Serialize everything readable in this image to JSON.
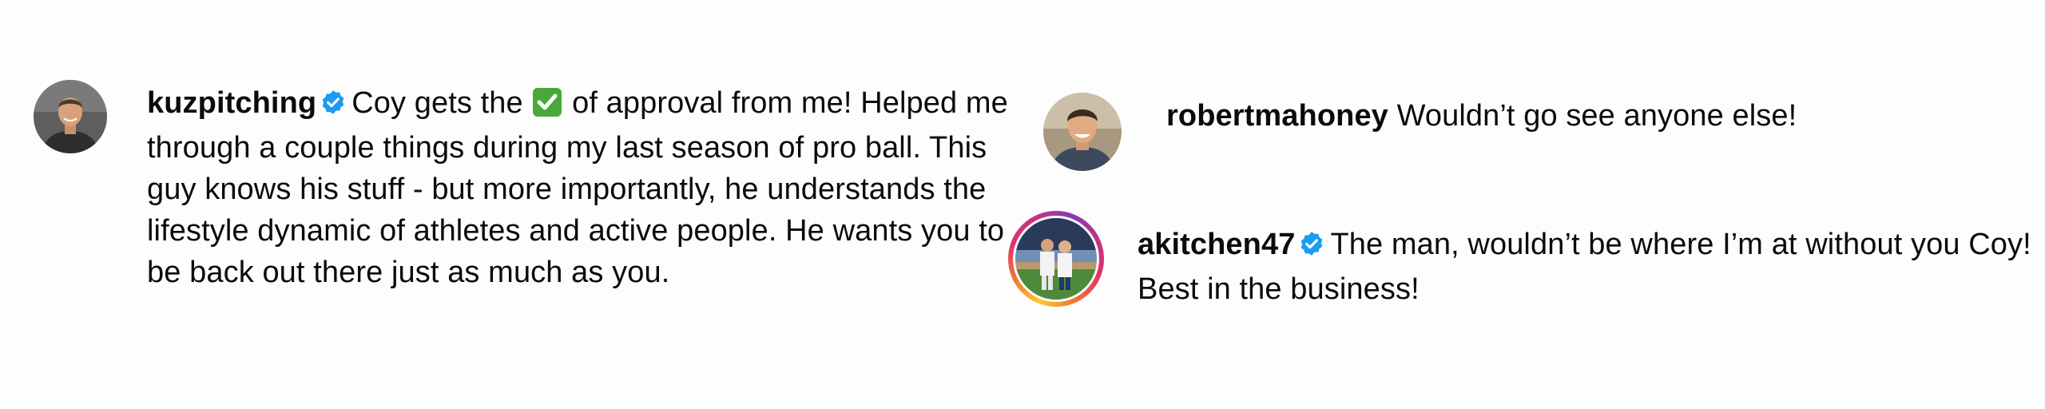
{
  "comments": [
    {
      "username": "kuzpitching",
      "verified": true,
      "avatar": "profile-photo",
      "text_before_emoji": "Coy gets the",
      "emoji": "check-mark-button",
      "text_after_emoji": "of approval from me! Helped me through a couple things during my last season of pro ball. This guy knows his stuff - but more importantly, he understands the lifestyle dynamic of athletes and active people. He wants you to be back out there just as much as you."
    },
    {
      "username": "robertmahoney",
      "verified": false,
      "avatar": "profile-photo",
      "text": "Wouldn’t go see anyone else!"
    },
    {
      "username": "akitchen47",
      "verified": true,
      "avatar": "story-ring-profile-photo",
      "text": "The man, wouldn’t be where I’m at without you Coy! Best in the business!"
    }
  ],
  "colors": {
    "verified_blue": "#1d9bf0",
    "emoji_green": "#4aa83a",
    "text": "#0b0b0b"
  }
}
